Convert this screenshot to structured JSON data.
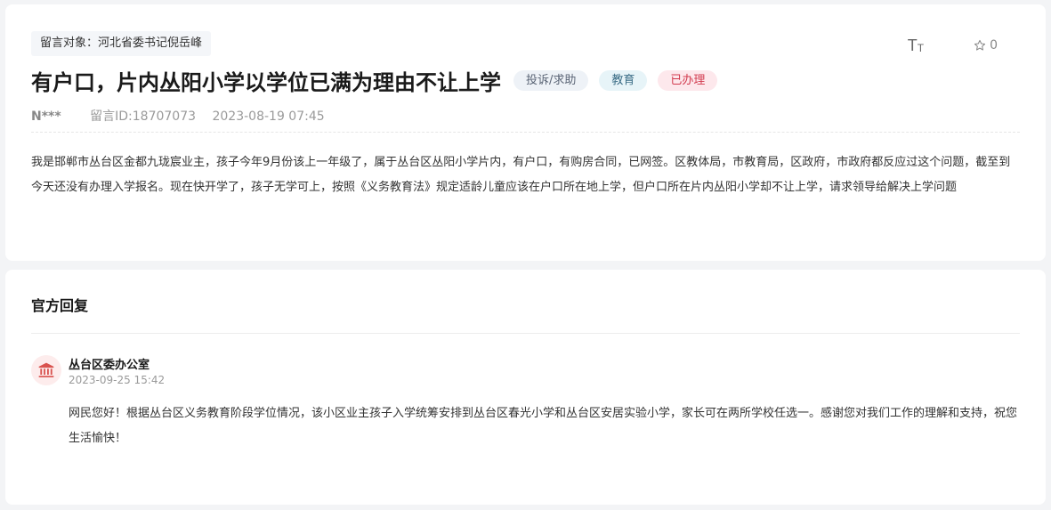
{
  "message": {
    "recipient": "留言对象：河北省委书记倪岳峰",
    "title": "有户口，片内丛阳小学以学位已满为理由不让上学",
    "tags": {
      "type": "投诉/求助",
      "category": "教育",
      "status": "已办理"
    },
    "author": "N***",
    "message_id": "留言ID:18707073",
    "datetime": "2023-08-19 07:45",
    "content": "我是邯郸市丛台区金都九珑宸业主，孩子今年9月份该上一年级了，属于丛台区丛阳小学片内，有户口，有购房合同，已网签。区教体局，市教育局，区政府，市政府都反应过这个问题，截至到今天还没有办理入学报名。现在快开学了，孩子无学可上，按照《义务教育法》规定适龄儿童应该在户口所在地上学，但户口所在片内丛阳小学却不让上学，请求领导给解决上学问题"
  },
  "toolbar": {
    "font_size_label_big": "T",
    "font_size_label_small": "T",
    "favorite_count": "0",
    "font_icon": "font-size-icon",
    "favorite_icon": "star-outline-icon"
  },
  "reply_section": {
    "title": "官方回复",
    "org_icon": "government-building-icon",
    "org_name": "丛台区委办公室",
    "datetime": "2023-09-25 15:42",
    "content": "网民您好！根据丛台区义务教育阶段学位情况，该小区业主孩子入学统筹安排到丛台区春光小学和丛台区安居实验小学，家长可在两所学校任选一。感谢您对我们工作的理解和支持，祝您生活愉快！"
  },
  "colors": {
    "page_background": "#f3f4f6",
    "status_tag_text": "#d23a4e",
    "status_tag_bg": "#fde8ec",
    "category_tag_text": "#3b6d86",
    "org_icon_color": "#d9534f"
  }
}
